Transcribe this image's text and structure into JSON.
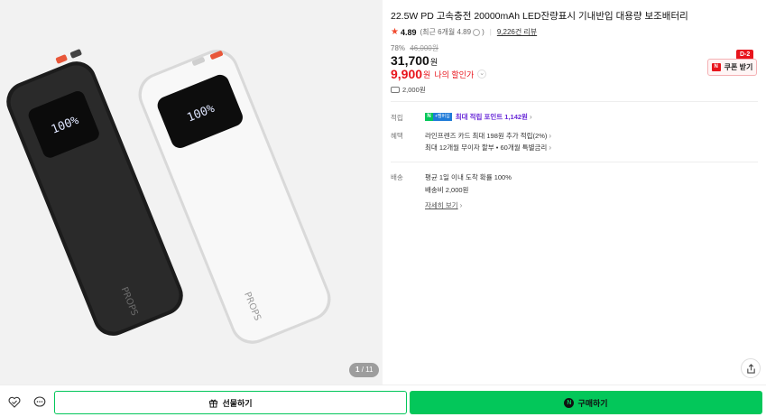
{
  "gallery": {
    "current": "1",
    "total": "11",
    "brand_mark_black": "PROPS",
    "brand_mark_white": "PROPS",
    "display_black": "100%",
    "display_white": "100%"
  },
  "product": {
    "title": "22.5W PD 고속충전 20000mAh LED잔량표시 기내반입 대용량 보조배터리",
    "rating": "4.89",
    "rating_sub": "(최근 6개월 4.89",
    "rating_sub_close": ")",
    "review_count": "9,226건 리뷰",
    "discount_rate": "78%",
    "original_price": "46,000원",
    "sale_price": "31,700",
    "won": "원",
    "my_discount_price": "9,900",
    "my_won": "원",
    "my_discount_label": "나의 할인가",
    "points_note": "2,000원"
  },
  "coupon": {
    "dday": "D-2",
    "n_mark": "N",
    "label": "쿠폰 받기"
  },
  "benefits": {
    "reward_label": "적립",
    "npay_n": "N",
    "npay_badge": "+멤버십",
    "reward_text": "최대 적립 포인트 1,142원",
    "benefit_label": "혜택",
    "benefit_line1": "라인프렌즈 카드 최대 198원 추가 적립(2%)",
    "benefit_line2": "최대 12개월 무이자 할부 • 60개월 특별금리",
    "shipping_label": "배송",
    "shipping_line1": "평균 1일 이내 도착 확률 100%",
    "shipping_line2": "배송비 2,000원",
    "detail_link": "자세히 보기"
  },
  "bottom": {
    "gift_label": "선물하기",
    "buy_n": "N",
    "buy_label": "구매하기"
  },
  "colors": {
    "naver_green": "#03c75a",
    "accent_red": "#e8141c",
    "npay_purple": "#6a2bd8"
  }
}
